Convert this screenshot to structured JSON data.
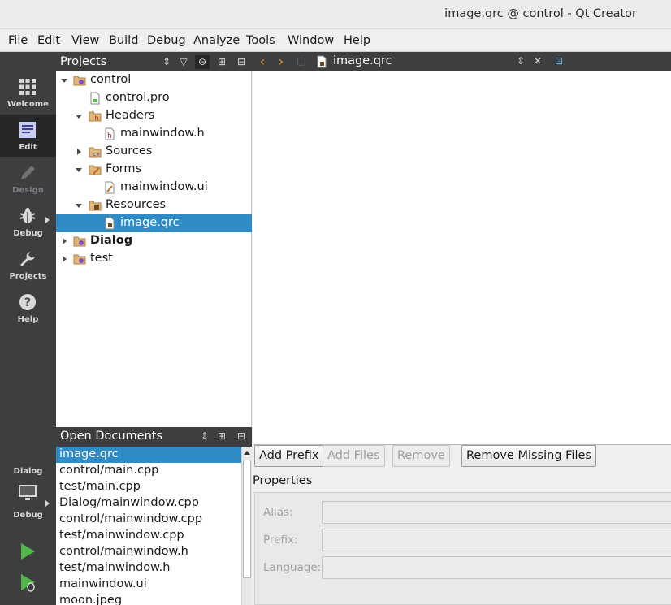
{
  "window": {
    "title": "image.qrc @ control - Qt Creator"
  },
  "menu": [
    {
      "label": "File"
    },
    {
      "label": "Edit"
    },
    {
      "label": "View"
    },
    {
      "label": "Build"
    },
    {
      "label": "Debug"
    },
    {
      "label": "Analyze"
    },
    {
      "label": "Tools"
    },
    {
      "label": "Window"
    },
    {
      "label": "Help"
    }
  ],
  "modes": [
    {
      "label": "Welcome",
      "icon": "grid-icon"
    },
    {
      "label": "Edit",
      "icon": "document-icon"
    },
    {
      "label": "Design",
      "icon": "pencil-icon"
    },
    {
      "label": "Debug",
      "icon": "bug-icon"
    },
    {
      "label": "Projects",
      "icon": "wrench-icon"
    },
    {
      "label": "Help",
      "icon": "question-icon"
    }
  ],
  "kit": {
    "project": "Dialog",
    "build": "Debug"
  },
  "projects_panel": {
    "title": "Projects",
    "tree": [
      {
        "label": "control"
      },
      {
        "label": "control.pro"
      },
      {
        "label": "Headers"
      },
      {
        "label": "mainwindow.h"
      },
      {
        "label": "Sources"
      },
      {
        "label": "Forms"
      },
      {
        "label": "mainwindow.ui"
      },
      {
        "label": "Resources"
      },
      {
        "label": "image.qrc"
      },
      {
        "label": "Dialog"
      },
      {
        "label": "test"
      }
    ]
  },
  "editor": {
    "filename": "image.qrc"
  },
  "qrc": {
    "add_prefix": "Add Prefix",
    "add_files": "Add Files",
    "remove": "Remove",
    "remove_missing": "Remove Missing Files",
    "properties": "Properties",
    "alias_label": "Alias:",
    "prefix_label": "Prefix:",
    "language_label": "Language:"
  },
  "open_documents": {
    "title": "Open Documents",
    "items": [
      "image.qrc",
      "control/main.cpp",
      "test/main.cpp",
      "Dialog/mainwindow.cpp",
      "control/mainwindow.cpp",
      "test/mainwindow.cpp",
      "control/mainwindow.h",
      "test/mainwindow.h",
      "mainwindow.ui",
      "moon.jpeg"
    ]
  },
  "colors": {
    "selection": "#308cc6",
    "sidebar": "#3c3e40",
    "run": "#50b648"
  }
}
